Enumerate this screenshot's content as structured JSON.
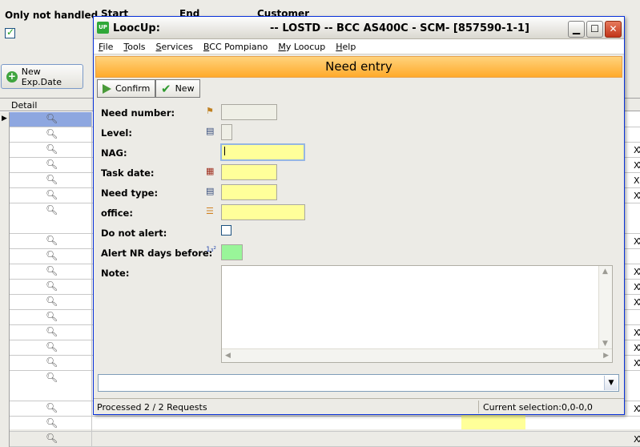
{
  "background": {
    "filter_label": "Only not handled",
    "col_labels": [
      "Start",
      "End",
      "Customer"
    ],
    "new_exp_button": "New Exp.Date",
    "grid_header": "Detail",
    "rows": [
      {
        "x": ""
      },
      {
        "x": ""
      },
      {
        "x": "XXX"
      },
      {
        "x": "XXX"
      },
      {
        "x": "X"
      },
      {
        "x": "XXX"
      },
      {
        "x": ""
      },
      {
        "x": "XXX"
      },
      {
        "x": ""
      },
      {
        "x": "XXX"
      },
      {
        "x": "XXX"
      },
      {
        "x": "XXX"
      },
      {
        "x": ""
      },
      {
        "x": "XXX"
      },
      {
        "x": "XXX"
      },
      {
        "x": "XXX"
      },
      {
        "x": ""
      },
      {
        "x": "XXX"
      },
      {
        "x": ""
      },
      {
        "x": "XXX"
      }
    ]
  },
  "dialog": {
    "app_name": "LoocUp:",
    "title": "-- LOSTD -- BCC AS400C - SCM- [857590-1-1]",
    "menu": [
      "File",
      "Tools",
      "Services",
      "BCC Pompiano",
      "My Loocup",
      "Help"
    ],
    "banner": "Need entry",
    "confirm_label": "Confirm",
    "new_label": "New",
    "fields": {
      "need_number": "Need number:",
      "level": "Level:",
      "nag": "NAG:",
      "task_date": "Task date:",
      "need_type": "Need type:",
      "office": "office:",
      "do_not_alert": "Do not alert:",
      "alert_nr_days": "Alert NR days before:",
      "note": "Note:"
    },
    "status_left": "Processed 2 / 2 Requests",
    "status_right": "Current selection:0,0-0,0"
  },
  "colors": {
    "banner": "#ffaa2b",
    "field_yellow": "#ffff9a",
    "field_green": "#99f599",
    "selected_row": "#8ea7e0"
  }
}
